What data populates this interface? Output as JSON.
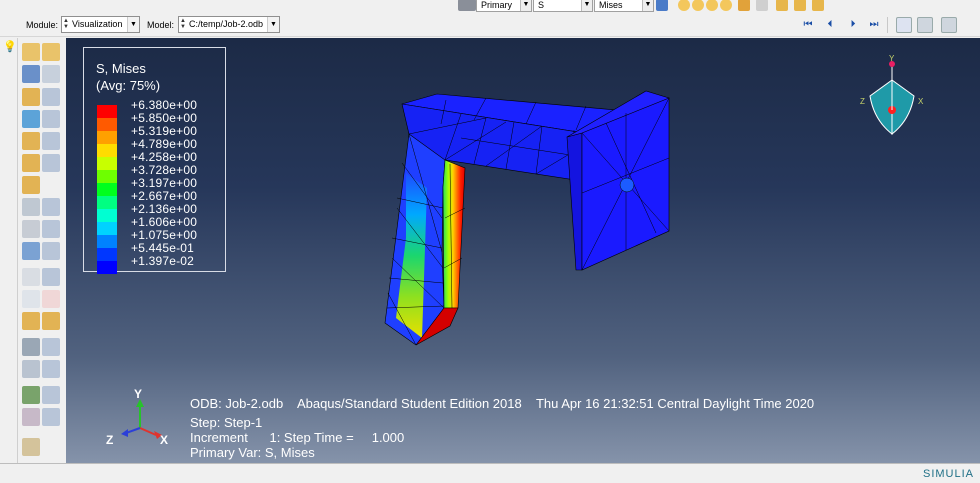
{
  "toolbar_top": {
    "primary_value": "Primary",
    "variable_value": "S",
    "invariant_value": "Mises"
  },
  "module_bar": {
    "module_label": "Module:",
    "module_value": "Visualization",
    "model_label": "Model:",
    "model_value": "C:/temp/Job-2.odb"
  },
  "legend": {
    "title": "S, Mises",
    "subtitle": "(Avg: 75%)",
    "levels": [
      {
        "value": "+6.380e+00",
        "color": "#ff0000"
      },
      {
        "value": "+5.850e+00",
        "color": "#ff5a00"
      },
      {
        "value": "+5.319e+00",
        "color": "#ffa000"
      },
      {
        "value": "+4.789e+00",
        "color": "#ffdc00"
      },
      {
        "value": "+4.258e+00",
        "color": "#c8ff00"
      },
      {
        "value": "+3.728e+00",
        "color": "#6eff00"
      },
      {
        "value": "+3.197e+00",
        "color": "#00ff1e"
      },
      {
        "value": "+2.667e+00",
        "color": "#00ff82"
      },
      {
        "value": "+2.136e+00",
        "color": "#00ffd2"
      },
      {
        "value": "+1.606e+00",
        "color": "#00d2ff"
      },
      {
        "value": "+1.075e+00",
        "color": "#0082ff"
      },
      {
        "value": "+5.445e-01",
        "color": "#0037ff"
      },
      {
        "value": "+1.397e-02",
        "color": "#0000ff"
      }
    ]
  },
  "info": {
    "line1": "ODB: Job-2.odb    Abaqus/Standard Student Edition 2018    Thu Apr 16 21:32:51 Central Daylight Time 2020",
    "line2": "Step: Step-1",
    "line3": "Increment      1: Step Time =     1.000",
    "line4": "Primary Var: S, Mises"
  },
  "triad": {
    "x": "X",
    "y": "Y",
    "z": "Z"
  },
  "view_cube": {
    "x": "X",
    "y": "Y",
    "z": "Z"
  },
  "brand": "SIMULIA"
}
